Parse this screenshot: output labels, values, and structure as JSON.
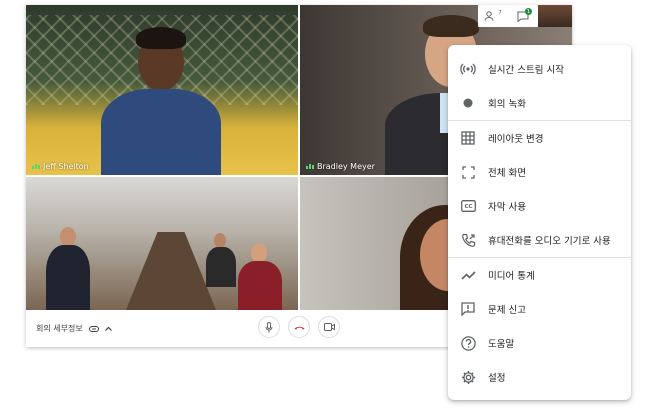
{
  "participants": [
    {
      "name": "Jeff Shelton"
    },
    {
      "name": "Bradley Meyer"
    }
  ],
  "toolbar": {
    "meeting_details": "회의 세부정보"
  },
  "top_bar": {
    "people_count": "7",
    "chat_badge": "1"
  },
  "menu": {
    "items": [
      {
        "label": "실시간 스트림 시작",
        "icon": "live-stream-icon"
      },
      {
        "label": "회의 녹화",
        "icon": "record-icon"
      },
      {
        "label": "레이아웃 변경",
        "icon": "grid-layout-icon"
      },
      {
        "label": "전체 화면",
        "icon": "fullscreen-icon"
      },
      {
        "label": "자막 사용",
        "icon": "captions-icon"
      },
      {
        "label": "휴대전화를 오디오 기기로 사용",
        "icon": "phone-audio-icon"
      },
      {
        "label": "미디어 통계",
        "icon": "trending-icon"
      },
      {
        "label": "문제 신고",
        "icon": "report-icon"
      },
      {
        "label": "도움말",
        "icon": "help-icon"
      },
      {
        "label": "설정",
        "icon": "settings-icon"
      }
    ]
  },
  "colors": {
    "hangup": "#d93025",
    "menu_text": "#202124",
    "icon": "#5f6368",
    "audio_indicator": "#5bd36b"
  }
}
